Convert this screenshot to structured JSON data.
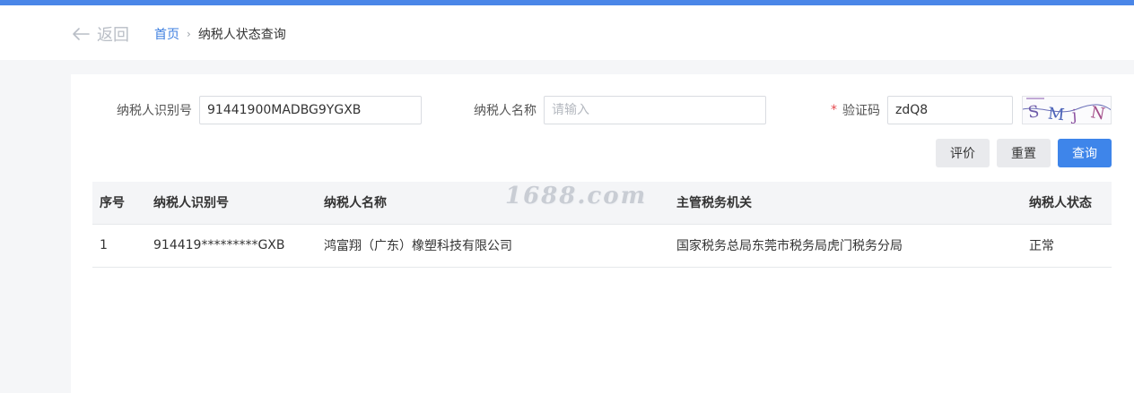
{
  "header": {
    "back_label": "返回",
    "breadcrumb": {
      "home": "首页",
      "separator": "›",
      "current": "纳税人状态查询"
    }
  },
  "form": {
    "taxpayer_id": {
      "label": "纳税人识别号",
      "value": "91441900MADBG9YGXB"
    },
    "taxpayer_name": {
      "label": "纳税人名称",
      "value": "",
      "placeholder": "请输入"
    },
    "captcha": {
      "required_mark": "*",
      "label": "验证码",
      "value": "zdQ8",
      "image_text": "SMjN"
    }
  },
  "actions": {
    "rate": "评价",
    "reset": "重置",
    "query": "查询"
  },
  "table": {
    "columns": [
      "序号",
      "纳税人识别号",
      "纳税人名称",
      "主管税务机关",
      "纳税人状态"
    ],
    "rows": [
      [
        "1",
        "914419*********GXB",
        "鸿富翔（广东）橡塑科技有限公司",
        "国家税务总局东莞市税务局虎门税务分局",
        "正常"
      ]
    ]
  },
  "watermark": "1688.com",
  "colors": {
    "accent": "#3e85ea",
    "top_bar": "#4a86e8",
    "link": "#3e7fe0",
    "required": "#e5484d"
  }
}
